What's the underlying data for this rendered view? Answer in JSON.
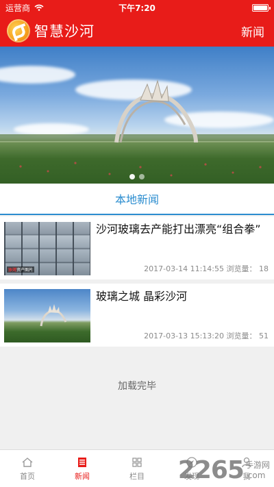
{
  "status_bar": {
    "carrier": "运营商",
    "time": "下午7:20"
  },
  "header": {
    "app_name": "智慧沙河",
    "page_title": "新闻"
  },
  "banner": {
    "slide_count": 2,
    "active_index": 0
  },
  "section": {
    "label": "本地新闻"
  },
  "news": [
    {
      "title": "沙河玻璃去产能打出漂亮“组合拳”",
      "date": "2017-03-14 11:14:55",
      "views_label": "浏览量：",
      "views": "18",
      "thumb_tag_red": "沙河",
      "thumb_tag": "资产图片"
    },
    {
      "title": "玻璃之城 晶彩沙河",
      "date": "2017-03-13 15:13:20",
      "views_label": "浏览量：",
      "views": "51"
    }
  ],
  "footer_message": "加载完毕",
  "tabbar": [
    {
      "label": "首页",
      "icon": "home-icon"
    },
    {
      "label": "新闻",
      "icon": "news-icon",
      "active": true
    },
    {
      "label": "栏目",
      "icon": "grid-icon"
    },
    {
      "label": "发现",
      "icon": "compass-icon"
    },
    {
      "label": "我",
      "icon": "user-icon"
    }
  ],
  "watermark": {
    "main": "2265",
    "sub": "手游网",
    "suffix": ".com"
  },
  "colors": {
    "brand_red": "#e81c19",
    "section_blue": "#2a8ccf"
  }
}
